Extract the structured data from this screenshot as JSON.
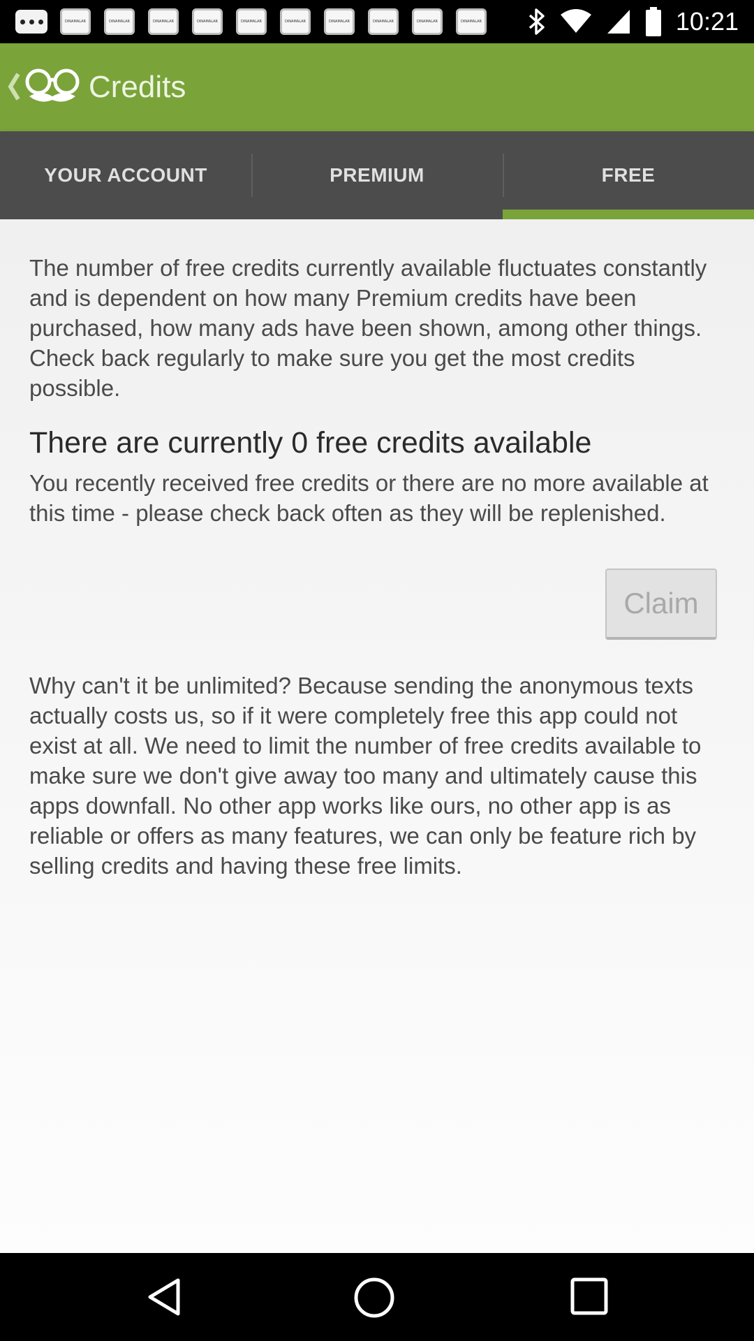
{
  "status_bar": {
    "time": "10:21",
    "notification_label": "DINAMALAR",
    "notification_count": 10,
    "icons": [
      "more-icon",
      "bluetooth-icon",
      "wifi-icon",
      "signal-icon",
      "battery-icon"
    ]
  },
  "app_bar": {
    "title": "Credits",
    "icons": [
      "back-chevron-icon",
      "app-logo-icon"
    ],
    "background": "#7aa33a"
  },
  "tabs": [
    {
      "label": "YOUR ACCOUNT",
      "active": false
    },
    {
      "label": "PREMIUM",
      "active": false
    },
    {
      "label": "FREE",
      "active": true
    }
  ],
  "content": {
    "intro": "The number of free credits currently available fluctuates constantly and is dependent on how many Premium credits have been purchased, how many ads have been shown, among other things. Check back regularly to make sure you get the most credits possible.",
    "heading": "There are currently 0 free credits available",
    "status_message": "You recently received free credits or there are no more available at this time - please check back often as they will be replenished.",
    "claim_label": "Claim",
    "explanation": "Why can't it be unlimited? Because sending the anonymous texts actually costs us, so if it were completely free this app could not exist at all. We need to limit the number of free credits available to make sure we don't give away too many and ultimately cause this apps downfall. No other app works like ours, no other app is as reliable or offers as many features, we can only be feature rich by selling credits and having these free limits."
  },
  "nav_bar": {
    "icons": [
      "back-triangle-icon",
      "home-circle-icon",
      "recent-square-icon"
    ]
  }
}
